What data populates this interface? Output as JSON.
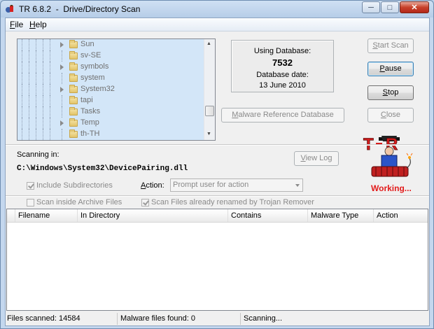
{
  "window": {
    "title": "TR 6.8.2  -  Drive/Directory Scan",
    "controls": {
      "minimize": "─",
      "maximize": "□",
      "close": "✕"
    }
  },
  "menu": [
    {
      "label": "File",
      "mnemonic": "F",
      "rest": "ile"
    },
    {
      "label": "Help",
      "mnemonic": "H",
      "rest": "elp"
    }
  ],
  "tree": {
    "items": [
      {
        "label": "Sun",
        "expandable": true
      },
      {
        "label": "sv-SE",
        "expandable": false
      },
      {
        "label": "symbols",
        "expandable": true
      },
      {
        "label": "system",
        "expandable": false
      },
      {
        "label": "System32",
        "expandable": true
      },
      {
        "label": "tapi",
        "expandable": false
      },
      {
        "label": "Tasks",
        "expandable": false
      },
      {
        "label": "Temp",
        "expandable": true
      },
      {
        "label": "th-TH",
        "expandable": false
      }
    ],
    "scroll_up": "▲",
    "scroll_down": "▼"
  },
  "database": {
    "using_label": "Using Database:",
    "count": "7532",
    "date_label": "Database date:",
    "date": "13 June 2010",
    "reference_button": {
      "mnemonic": "M",
      "rest": "alware Reference Database"
    }
  },
  "actions": {
    "start_scan": {
      "mnemonic": "S",
      "rest": "tart Scan",
      "enabled": false
    },
    "pause": {
      "mnemonic": "P",
      "rest": "ause",
      "enabled": true
    },
    "stop": {
      "mnemonic": "S",
      "rest": "top",
      "enabled": true
    },
    "close": {
      "mnemonic": "C",
      "rest": "lose",
      "enabled": false
    }
  },
  "logo": {
    "text": "T-R",
    "icon": "trojan-remover-logo"
  },
  "status_indicator": "Working...",
  "scan": {
    "scanning_in_label": "Scanning in:",
    "current_path": "C:\\Windows\\System32\\DevicePairing.dll",
    "view_log": {
      "mnemonic": "V",
      "rest": "iew Log"
    }
  },
  "options": {
    "include_subdirectories": {
      "label": "Include Subdirectories",
      "checked": true
    },
    "action_label": {
      "mnemonic": "A",
      "rest": "ction:"
    },
    "action_value": "Prompt user for action",
    "scan_archives": {
      "label": "Scan inside Archive Files",
      "checked": false
    },
    "scan_renamed": {
      "label": "Scan Files already renamed by Trojan Remover",
      "checked": true
    }
  },
  "results": {
    "columns": [
      "Filename",
      "In Directory",
      "Contains",
      "Malware Type",
      "Action"
    ],
    "rows": []
  },
  "statusbar": {
    "files_scanned": "Files scanned: 14584",
    "malware_found": "Malware files found: 0",
    "state": "Scanning..."
  },
  "colors": {
    "working": "#e21b1b",
    "tree_selection": "#d3e6f8",
    "logo_red": "#d61e1e"
  }
}
